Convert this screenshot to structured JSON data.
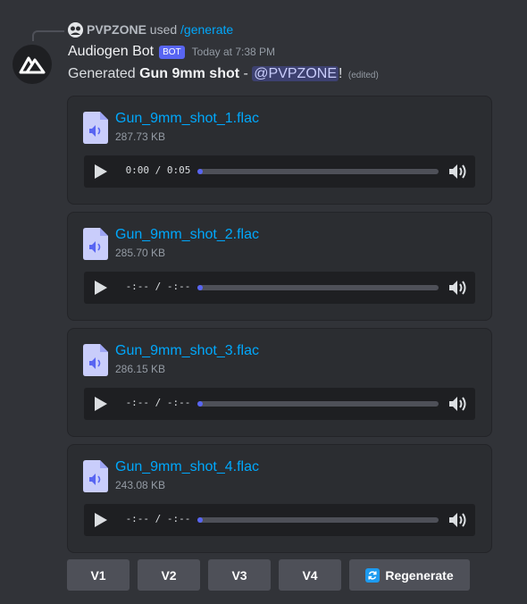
{
  "reply": {
    "user": "PVPZONE",
    "used": "used",
    "command": "/generate"
  },
  "message": {
    "bot_name": "Audiogen Bot",
    "bot_tag": "BOT",
    "timestamp": "Today at 7:38 PM",
    "text_prefix": "Generated ",
    "bold_text": "Gun 9mm shot",
    "text_dash": " - ",
    "mention": "@PVPZONE",
    "text_suffix": "!",
    "edited": "(edited)"
  },
  "attachments": [
    {
      "name": "Gun_9mm_shot_1.flac",
      "size": "287.73 KB",
      "time": "0:00 / 0:05"
    },
    {
      "name": "Gun_9mm_shot_2.flac",
      "size": "285.70 KB",
      "time": "-:-- / -:--"
    },
    {
      "name": "Gun_9mm_shot_3.flac",
      "size": "286.15 KB",
      "time": "-:-- / -:--"
    },
    {
      "name": "Gun_9mm_shot_4.flac",
      "size": "243.08 KB",
      "time": "-:-- / -:--"
    }
  ],
  "buttons": {
    "v1": "V1",
    "v2": "V2",
    "v3": "V3",
    "v4": "V4",
    "regenerate": "Regenerate"
  },
  "colors": {
    "background": "#313338",
    "link": "#00a8fc",
    "accent": "#5865f2",
    "button": "#4e5058"
  }
}
